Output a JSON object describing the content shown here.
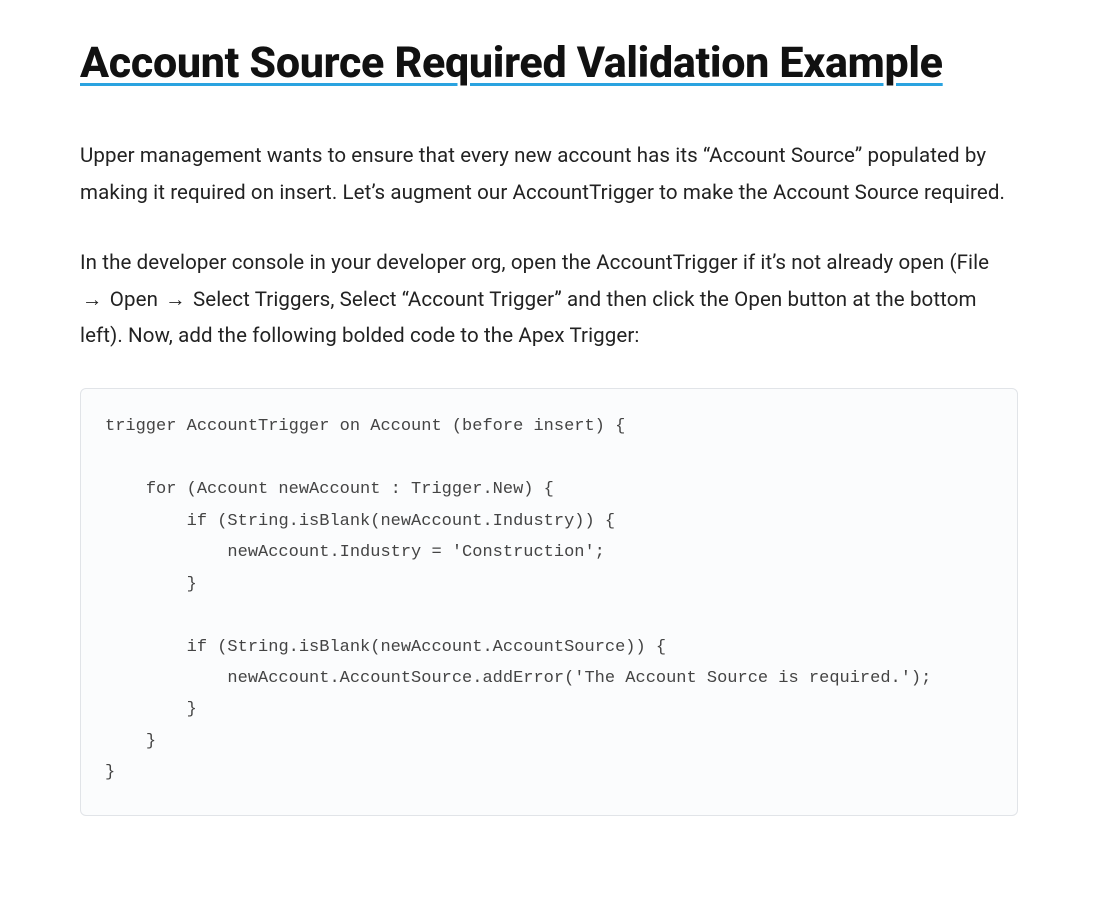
{
  "heading": "Account Source Required Validation Example",
  "paragraph1": "Upper management wants to ensure that every new account has its “Account Source” populated by making it required on insert. Let’s augment our AccountTrigger to make the Account Source required.",
  "paragraph2_a": "In the developer console in your developer org, open the AccountTrigger if it’s not already open (File ",
  "arrow": "→",
  "paragraph2_b": " Open ",
  "paragraph2_c": " Select Triggers, Select “Account Trigger” and then click the Open button at the bottom left). Now, add the following bolded code to the Apex Trigger:",
  "code": "trigger AccountTrigger on Account (before insert) {\n\n    for (Account newAccount : Trigger.New) {\n        if (String.isBlank(newAccount.Industry)) {\n            newAccount.Industry = 'Construction';\n        }\n\n        if (String.isBlank(newAccount.AccountSource)) {\n            newAccount.AccountSource.addError('The Account Source is required.');\n        }\n    }\n}"
}
